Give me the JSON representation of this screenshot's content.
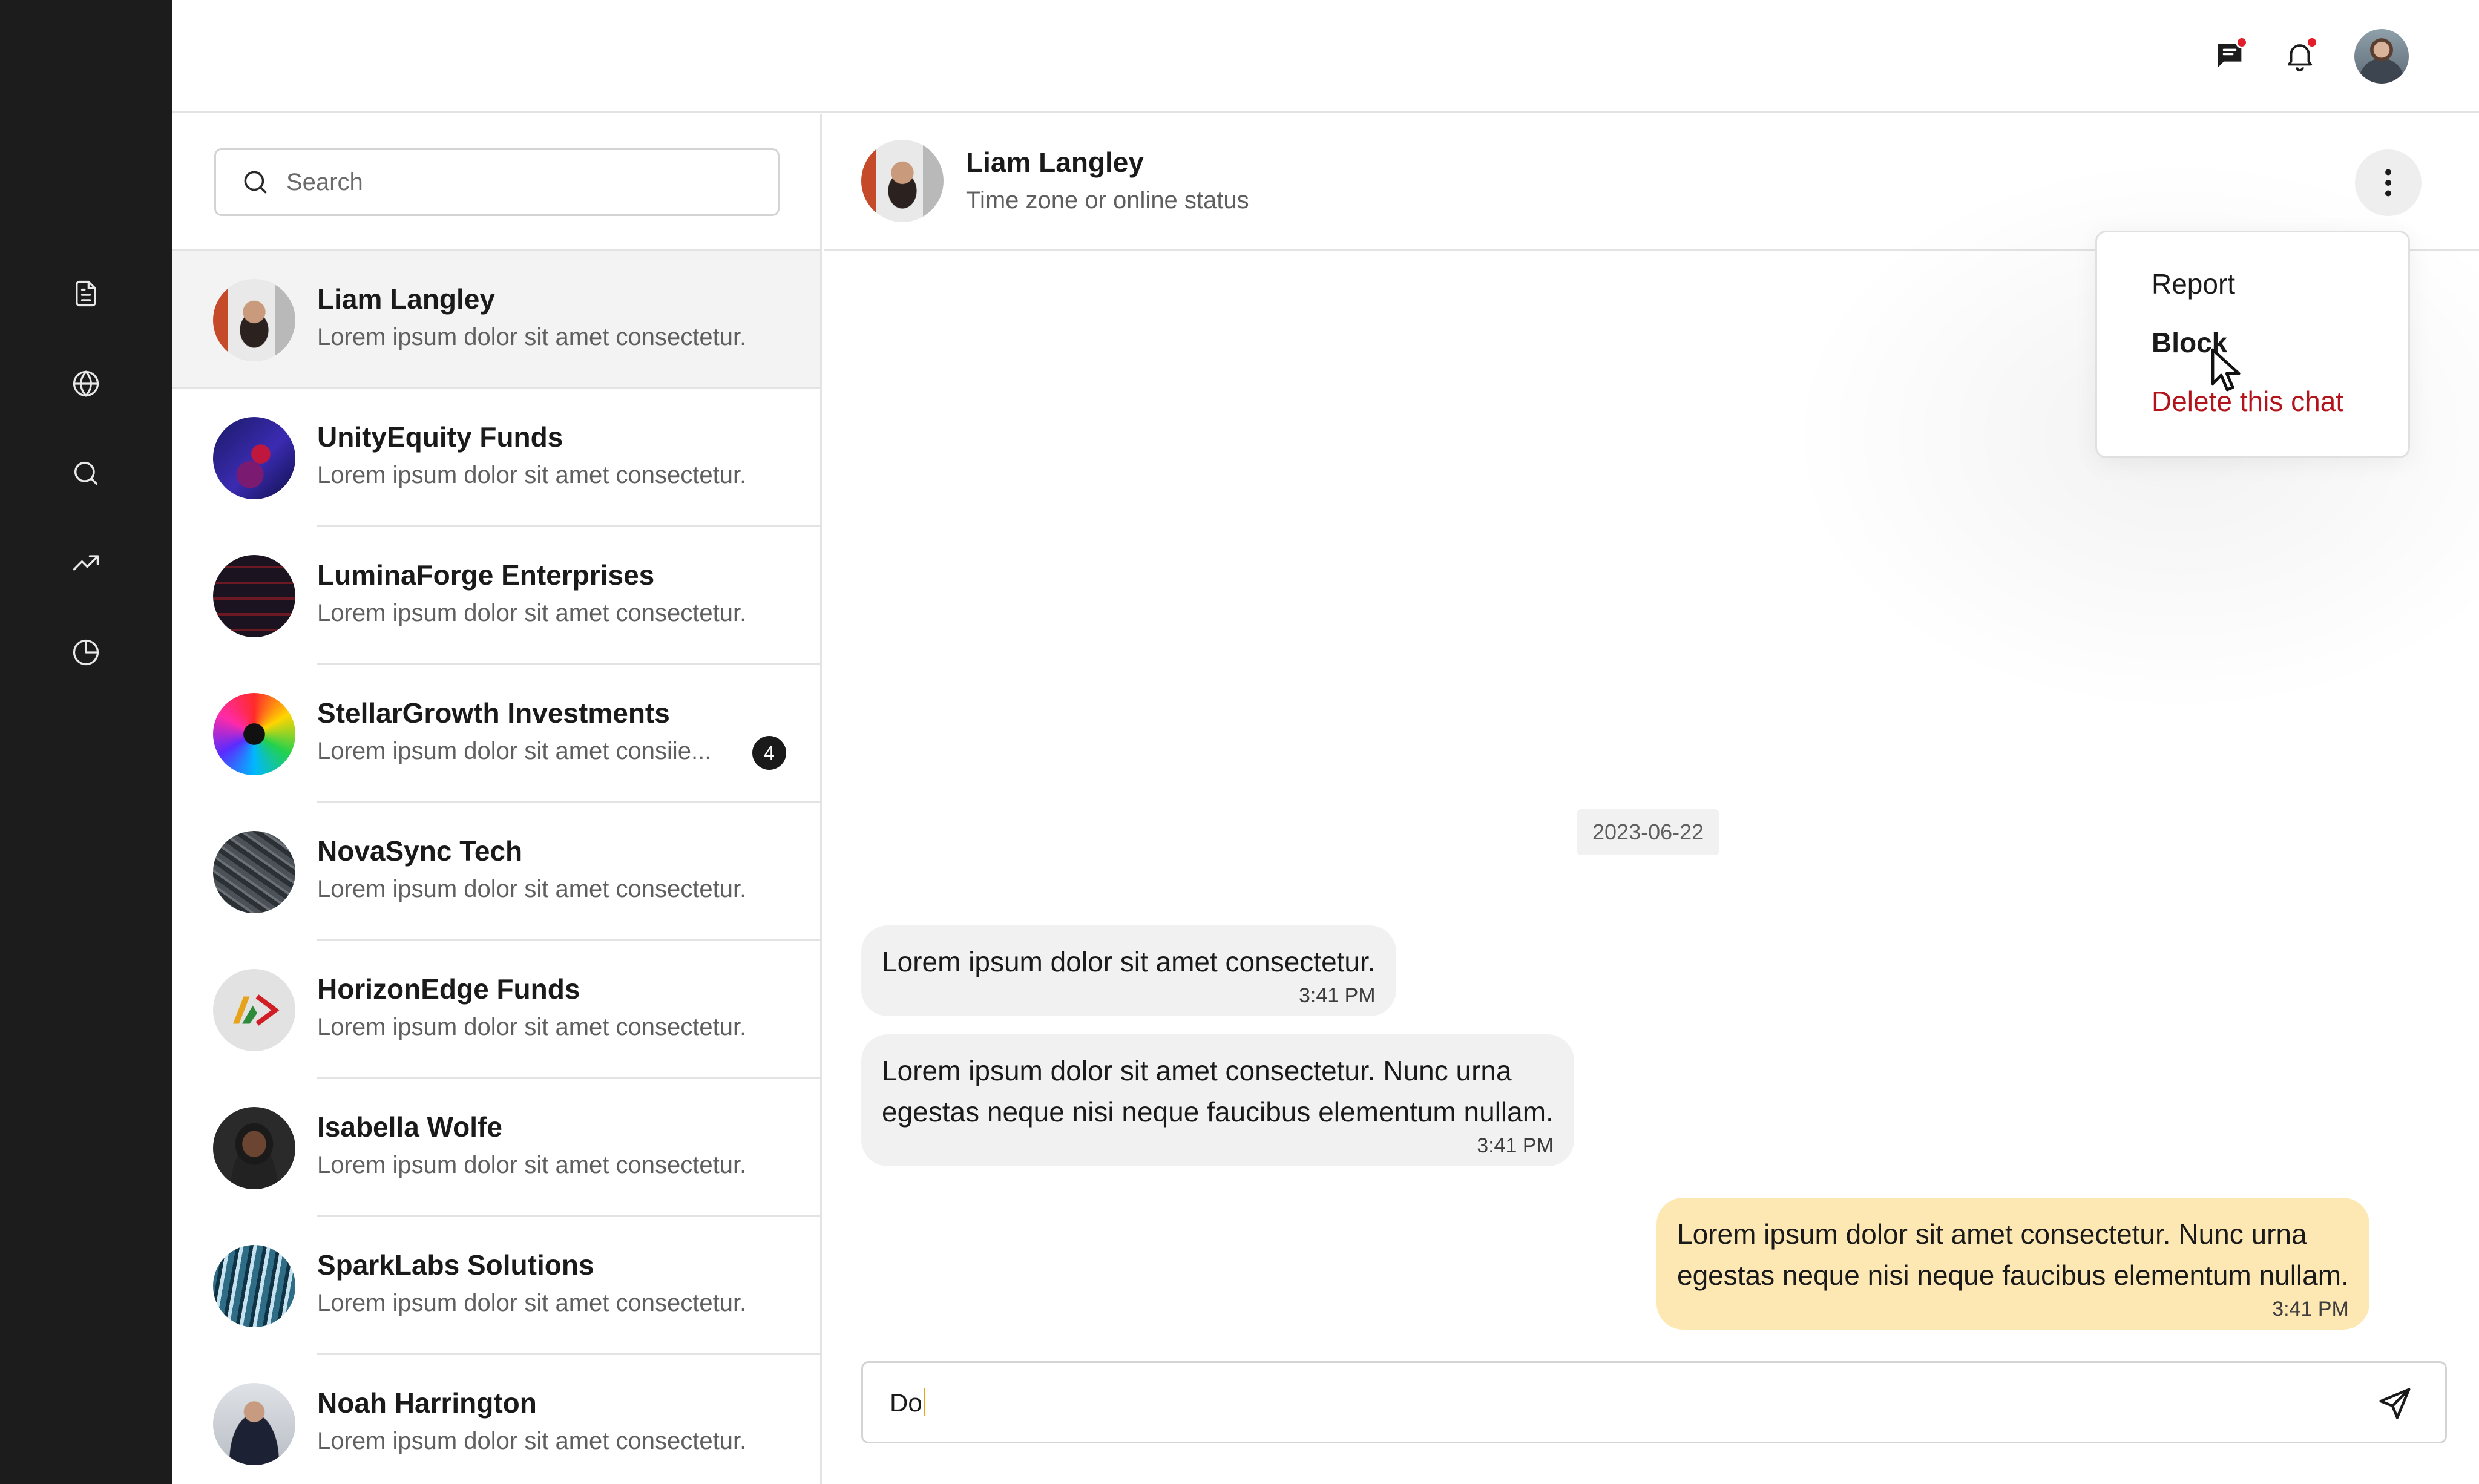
{
  "search": {
    "placeholder": "Search"
  },
  "rail": {
    "icons": [
      "document-icon",
      "globe-icon",
      "search-icon",
      "trending-up-icon",
      "pie-chart-icon"
    ]
  },
  "topbar": {
    "icons": [
      "chat-icon",
      "bell-icon"
    ]
  },
  "conversations": [
    {
      "name": "Liam Langley",
      "preview": "Lorem ipsum dolor sit amet consectetur.",
      "active": true
    },
    {
      "name": "UnityEquity Funds",
      "preview": "Lorem ipsum dolor sit amet consectetur."
    },
    {
      "name": "LuminaForge Enterprises",
      "preview": "Lorem ipsum dolor sit amet consectetur."
    },
    {
      "name": "StellarGrowth Investments",
      "preview": "Lorem ipsum dolor sit amet consiie...",
      "unread": "4"
    },
    {
      "name": "NovaSync Tech",
      "preview": "Lorem ipsum dolor sit amet consectetur."
    },
    {
      "name": "HorizonEdge Funds",
      "preview": "Lorem ipsum dolor sit amet consectetur."
    },
    {
      "name": "Isabella Wolfe",
      "preview": "Lorem ipsum dolor sit amet consectetur."
    },
    {
      "name": "SparkLabs Solutions",
      "preview": "Lorem ipsum dolor sit amet consectetur."
    },
    {
      "name": "Noah Harrington",
      "preview": "Lorem ipsum dolor sit amet consectetur."
    }
  ],
  "chat": {
    "name": "Liam Langley",
    "status": "Time zone or online status",
    "date": "2023-06-22",
    "messages": [
      {
        "dir": "in",
        "lines": [
          "Lorem ipsum dolor sit amet consectetur."
        ],
        "time": "3:41 PM"
      },
      {
        "dir": "in",
        "lines": [
          "Lorem ipsum dolor sit amet consectetur. Nunc urna",
          "egestas neque nisi neque faucibus elementum nullam."
        ],
        "time": "3:41 PM"
      },
      {
        "dir": "out",
        "lines": [
          "Lorem ipsum dolor sit amet consectetur. Nunc urna",
          "egestas neque nisi neque faucibus elementum nullam."
        ],
        "time": "3:41 PM"
      }
    ],
    "draft": "Do"
  },
  "menu": {
    "report": "Report",
    "block": "Block",
    "delete": "Delete this chat"
  },
  "colors": {
    "rail": "#1c1c1c",
    "outgoing_bubble": "#fde8b4",
    "incoming_bubble": "#f1f1f1",
    "danger": "#b3141c",
    "notification_dot": "#e11d2a"
  }
}
